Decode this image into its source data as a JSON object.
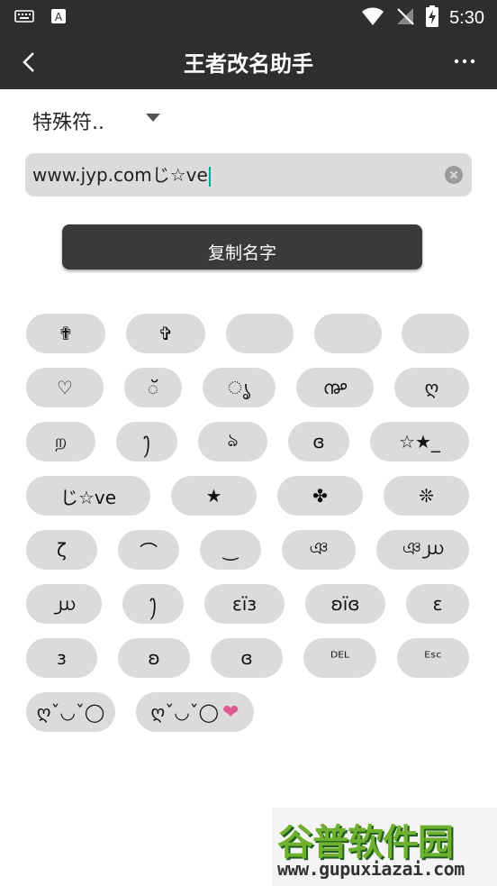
{
  "status_bar": {
    "time": "5:30",
    "icons": [
      "keyboard-icon",
      "font-a-icon",
      "wifi-icon",
      "no-signal-icon",
      "battery-charging-icon"
    ]
  },
  "app_bar": {
    "title": "王者改名助手",
    "back_icon": "chevron-left-icon",
    "more_icon": "more-dots-icon"
  },
  "dropdown": {
    "selected": "特殊符.."
  },
  "name_input": {
    "value": "www.jyp.comじ☆ve"
  },
  "copy_button": {
    "label": "复制名字"
  },
  "symbols": {
    "row1": [
      "✟",
      "✞",
      "",
      "",
      ""
    ],
    "row2": [
      "♡",
      "ॅ",
      "ൃ",
      "൲",
      "ღ"
    ],
    "row3": [
      "ற",
      "ꫂ",
      "ঌ",
      "ɞ",
      "☆★_"
    ],
    "row4": [
      "じ☆ve",
      "★",
      "✤",
      "❊"
    ],
    "row5": [
      "ζ",
      "⌒",
      "‿",
      "ঞ",
      "ঞ൰"
    ],
    "row6": [
      "൰",
      "ꫂ",
      "εïз",
      "ʚïɞ",
      "ɛ"
    ],
    "row7": [
      "з",
      "ʚ",
      "ɞ",
      "ᴰᴱᴸ",
      "ᴱˢᶜ"
    ],
    "row8": [
      "ღˇ◡ˇ◯",
      "ღˇ◡ˇ◯"
    ],
    "heart": "❤"
  },
  "watermark": {
    "title": "谷普软件园",
    "url": "www.gupuxiazai.com"
  }
}
